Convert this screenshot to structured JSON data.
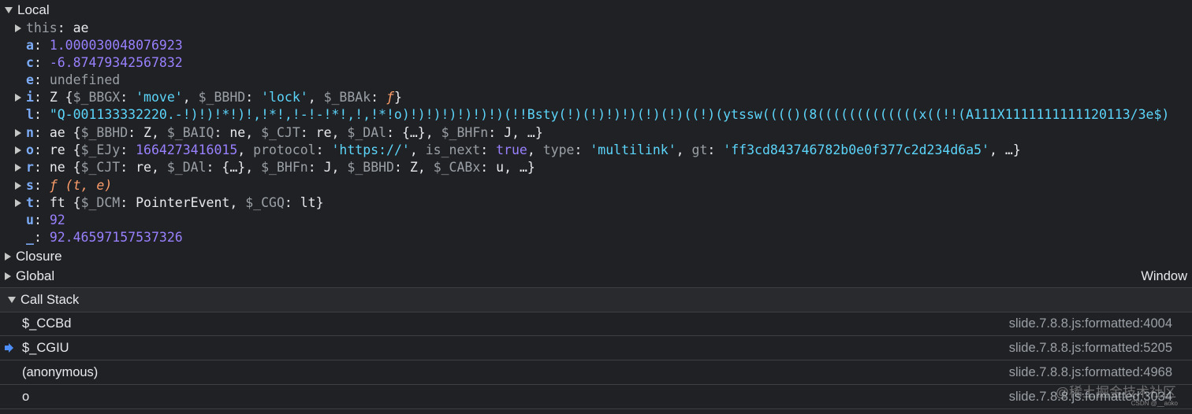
{
  "scope": {
    "local_label": "Local",
    "closure_label": "Closure",
    "global_label": "Global",
    "global_value": "Window",
    "vars": {
      "this_key": "this",
      "this_val": "ae",
      "a_key": "a",
      "a_val": "1.000030048076923",
      "c_key": "c",
      "c_val": "-6.87479342567832",
      "e_key": "e",
      "e_val": "undefined",
      "i_key": "i",
      "i_type": "Z",
      "i_p1k": "$_BBGX",
      "i_p1v": "'move'",
      "i_p2k": "$_BBHD",
      "i_p2v": "'lock'",
      "i_p3k": "$_BBAk",
      "i_p3v": "ƒ",
      "l_key": "l",
      "l_val": "\"Q-001133332220.-!)!)!*!)!,!*!,!-!-!*!,!,!*!o)!)!)!)!)!)!)(!!Bsty(!)(!)!)!)(!)(!)((!)(ytssw(((()(8(((((((((((((x((!!(A111X1111111111120113/3e$)",
      "n_key": "n",
      "n_type": "ae",
      "n_p1k": "$_BBHD",
      "n_p1v": "Z",
      "n_p2k": "$_BAIQ",
      "n_p2v": "ne",
      "n_p3k": "$_CJT",
      "n_p3v": "re",
      "n_p4k": "$_DAl",
      "n_p4v": "{…}",
      "n_p5k": "$_BHFn",
      "n_p5v": "J",
      "n_more": "…",
      "o_key": "o",
      "o_type": "re",
      "o_p1k": "$_EJy",
      "o_p1v": "1664273416015",
      "o_p2k": "protocol",
      "o_p2v": "'https://'",
      "o_p3k": "is_next",
      "o_p3v": "true",
      "o_p4k": "type",
      "o_p4v": "'multilink'",
      "o_p5k": "gt",
      "o_p5v": "'ff3cd843746782b0e0f377c2d234d6a5'",
      "o_more": "…",
      "r_key": "r",
      "r_type": "ne",
      "r_p1k": "$_CJT",
      "r_p1v": "re",
      "r_p2k": "$_DAl",
      "r_p2v": "{…}",
      "r_p3k": "$_BHFn",
      "r_p3v": "J",
      "r_p4k": "$_BBHD",
      "r_p4v": "Z",
      "r_p5k": "$_CABx",
      "r_p5v": "u",
      "r_more": "…",
      "s_key": "s",
      "s_val": "ƒ (t, e)",
      "t_key": "t",
      "t_type": "ft",
      "t_p1k": "$_DCM",
      "t_p1v": "PointerEvent",
      "t_p2k": "$_CGQ",
      "t_p2v": "lt",
      "u_key": "u",
      "u_val": "92",
      "_key": "_",
      "_val": "92.46597157537326"
    }
  },
  "call_stack": {
    "title": "Call Stack",
    "frames": [
      {
        "name": "$_CCBd",
        "location": "slide.7.8.8.js:formatted:4004"
      },
      {
        "name": "$_CGIU",
        "location": "slide.7.8.8.js:formatted:5205"
      },
      {
        "name": "(anonymous)",
        "location": "slide.7.8.8.js:formatted:4968"
      },
      {
        "name": "o",
        "location": "slide.7.8.8.js:formatted:3034"
      }
    ]
  },
  "watermark": {
    "main": "@稀土掘金技术社区",
    "small": "CSDN @__aoko"
  },
  "colors": {
    "background": "#202124",
    "number": "#9980ff",
    "string": "#5cd5fb",
    "function": "#ff9e6b",
    "key": "#7cacf8",
    "current_frame_arrow": "#4d8ef7"
  }
}
